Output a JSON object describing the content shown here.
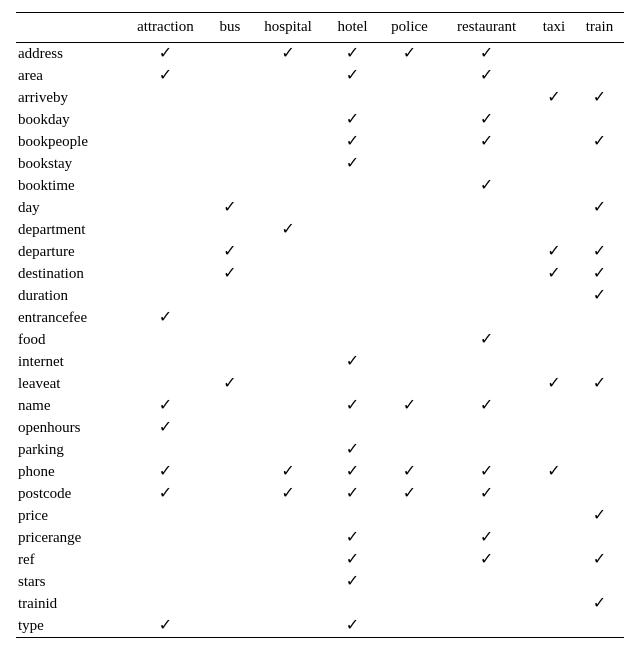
{
  "chart_data": {
    "type": "table",
    "columns": [
      "attraction",
      "bus",
      "hospital",
      "hotel",
      "police",
      "restaurant",
      "taxi",
      "train"
    ],
    "rows": [
      {
        "label": "address",
        "values": [
          true,
          false,
          true,
          true,
          true,
          true,
          false,
          false
        ]
      },
      {
        "label": "area",
        "values": [
          true,
          false,
          false,
          true,
          false,
          true,
          false,
          false
        ]
      },
      {
        "label": "arriveby",
        "values": [
          false,
          false,
          false,
          false,
          false,
          false,
          true,
          true
        ]
      },
      {
        "label": "bookday",
        "values": [
          false,
          false,
          false,
          true,
          false,
          true,
          false,
          false
        ]
      },
      {
        "label": "bookpeople",
        "values": [
          false,
          false,
          false,
          true,
          false,
          true,
          false,
          true
        ]
      },
      {
        "label": "bookstay",
        "values": [
          false,
          false,
          false,
          true,
          false,
          false,
          false,
          false
        ]
      },
      {
        "label": "booktime",
        "values": [
          false,
          false,
          false,
          false,
          false,
          true,
          false,
          false
        ]
      },
      {
        "label": "day",
        "values": [
          false,
          true,
          false,
          false,
          false,
          false,
          false,
          true
        ]
      },
      {
        "label": "department",
        "values": [
          false,
          false,
          true,
          false,
          false,
          false,
          false,
          false
        ]
      },
      {
        "label": "departure",
        "values": [
          false,
          true,
          false,
          false,
          false,
          false,
          true,
          true
        ]
      },
      {
        "label": "destination",
        "values": [
          false,
          true,
          false,
          false,
          false,
          false,
          true,
          true
        ]
      },
      {
        "label": "duration",
        "values": [
          false,
          false,
          false,
          false,
          false,
          false,
          false,
          true
        ]
      },
      {
        "label": "entrancefee",
        "values": [
          true,
          false,
          false,
          false,
          false,
          false,
          false,
          false
        ]
      },
      {
        "label": "food",
        "values": [
          false,
          false,
          false,
          false,
          false,
          true,
          false,
          false
        ]
      },
      {
        "label": "internet",
        "values": [
          false,
          false,
          false,
          true,
          false,
          false,
          false,
          false
        ]
      },
      {
        "label": "leaveat",
        "values": [
          false,
          true,
          false,
          false,
          false,
          false,
          true,
          true
        ]
      },
      {
        "label": "name",
        "values": [
          true,
          false,
          false,
          true,
          true,
          true,
          false,
          false
        ]
      },
      {
        "label": "openhours",
        "values": [
          true,
          false,
          false,
          false,
          false,
          false,
          false,
          false
        ]
      },
      {
        "label": "parking",
        "values": [
          false,
          false,
          false,
          true,
          false,
          false,
          false,
          false
        ]
      },
      {
        "label": "phone",
        "values": [
          true,
          false,
          true,
          true,
          true,
          true,
          true,
          false
        ]
      },
      {
        "label": "postcode",
        "values": [
          true,
          false,
          true,
          true,
          true,
          true,
          false,
          false
        ]
      },
      {
        "label": "price",
        "values": [
          false,
          false,
          false,
          false,
          false,
          false,
          false,
          true
        ]
      },
      {
        "label": "pricerange",
        "values": [
          false,
          false,
          false,
          true,
          false,
          true,
          false,
          false
        ]
      },
      {
        "label": "ref",
        "values": [
          false,
          false,
          false,
          true,
          false,
          true,
          false,
          true
        ]
      },
      {
        "label": "stars",
        "values": [
          false,
          false,
          false,
          true,
          false,
          false,
          false,
          false
        ]
      },
      {
        "label": "trainid",
        "values": [
          false,
          false,
          false,
          false,
          false,
          false,
          false,
          true
        ]
      },
      {
        "label": "type",
        "values": [
          true,
          false,
          false,
          true,
          false,
          false,
          false,
          false
        ]
      }
    ]
  },
  "checkmark": "✓"
}
